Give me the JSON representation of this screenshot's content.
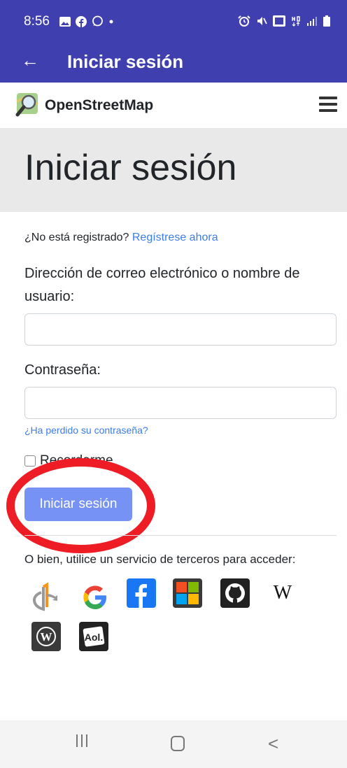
{
  "status_bar": {
    "time": "8:56",
    "left_icons": [
      "gallery-icon",
      "facebook-icon",
      "whatsapp-icon",
      "dot-icon"
    ],
    "right_icons": [
      "alarm-icon",
      "mute-icon",
      "volte-icon",
      "4g-icon",
      "signal-icon",
      "battery-icon"
    ]
  },
  "app_bar": {
    "title": "Iniciar sesión"
  },
  "header": {
    "brand": "OpenStreetMap"
  },
  "page": {
    "title": "Iniciar sesión",
    "register_prompt": "¿No está registrado?",
    "register_link": "Regístrese ahora",
    "email_label": "Dirección de correo electrónico o nombre de usuario:",
    "email_value": "",
    "password_label": "Contraseña:",
    "password_value": "",
    "lost_password": "¿Ha perdido su contraseña?",
    "remember_label": "Recordarme",
    "login_button": "Iniciar sesión",
    "third_party_text": "O bien, utilice un servicio de terceros para acceder:"
  },
  "providers": [
    "openid",
    "google",
    "facebook",
    "microsoft",
    "github",
    "wikipedia",
    "wordpress",
    "aol"
  ],
  "colors": {
    "bar": "#3f3fb0",
    "link": "#3c7de7",
    "button": "#7592f4",
    "highlight": "#ee1c25"
  }
}
